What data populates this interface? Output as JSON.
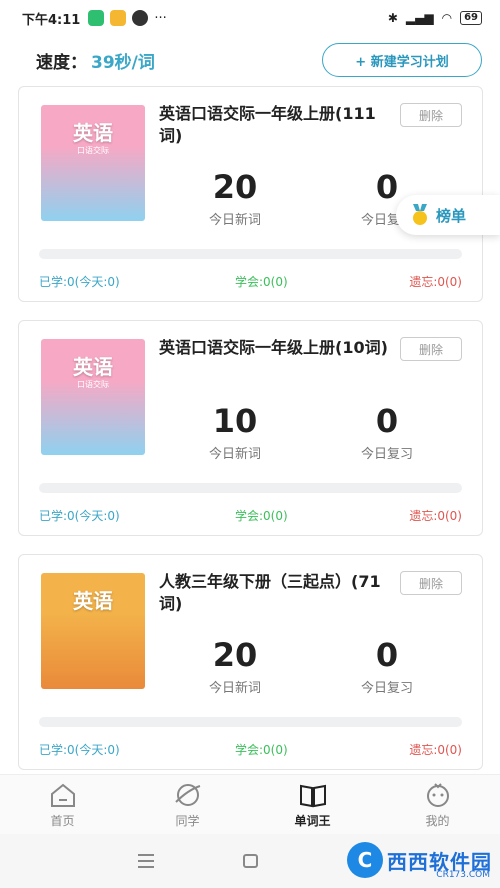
{
  "status_bar": {
    "time": "下午4:11",
    "dots": "···",
    "battery": "69"
  },
  "header": {
    "speed_label": "速度：",
    "speed_value": "39秒/词",
    "new_plan_label": "+ 新建学习计划"
  },
  "rank": {
    "label": "榜单"
  },
  "books": [
    {
      "cover_title": "英语",
      "cover_sub": "口语交际",
      "cover_colors": [
        "#f7a8c4",
        "#8fd1ef"
      ],
      "title": "英语口语交际一年级上册(111词)",
      "delete_label": "删除",
      "new_words": "20",
      "new_words_label": "今日新词",
      "review": "0",
      "review_label": "今日复习",
      "progress": 0,
      "learned": "已学:0(今天:0)",
      "mastered": "学会:0(0)",
      "forgotten": "遗忘:0(0)"
    },
    {
      "cover_title": "英语",
      "cover_sub": "口语交际",
      "cover_colors": [
        "#f7a8c4",
        "#8fd1ef"
      ],
      "title": "英语口语交际一年级上册(10词)",
      "delete_label": "删除",
      "new_words": "10",
      "new_words_label": "今日新词",
      "review": "0",
      "review_label": "今日复习",
      "progress": 0,
      "learned": "已学:0(今天:0)",
      "mastered": "学会:0(0)",
      "forgotten": "遗忘:0(0)"
    },
    {
      "cover_title": "英语",
      "cover_sub": "",
      "cover_colors": [
        "#f3b24a",
        "#e98a3a"
      ],
      "title": "人教三年级下册（三起点）(71词)",
      "delete_label": "删除",
      "new_words": "20",
      "new_words_label": "今日新词",
      "review": "0",
      "review_label": "今日复习",
      "progress": 0,
      "learned": "已学:0(今天:0)",
      "mastered": "学会:0(0)",
      "forgotten": "遗忘:0(0)"
    }
  ],
  "tabs": [
    {
      "label": "首页",
      "icon": "home-icon"
    },
    {
      "label": "同学",
      "icon": "planet-icon"
    },
    {
      "label": "单词王",
      "icon": "book-icon",
      "active": true
    },
    {
      "label": "我的",
      "icon": "face-icon"
    }
  ],
  "watermark": {
    "logo": "C",
    "text": "西西软件园",
    "sub": "CR173.COM"
  },
  "colors": {
    "accent": "#3aa6c8",
    "mastered": "#3cbf5b",
    "forgotten": "#e0554f"
  }
}
